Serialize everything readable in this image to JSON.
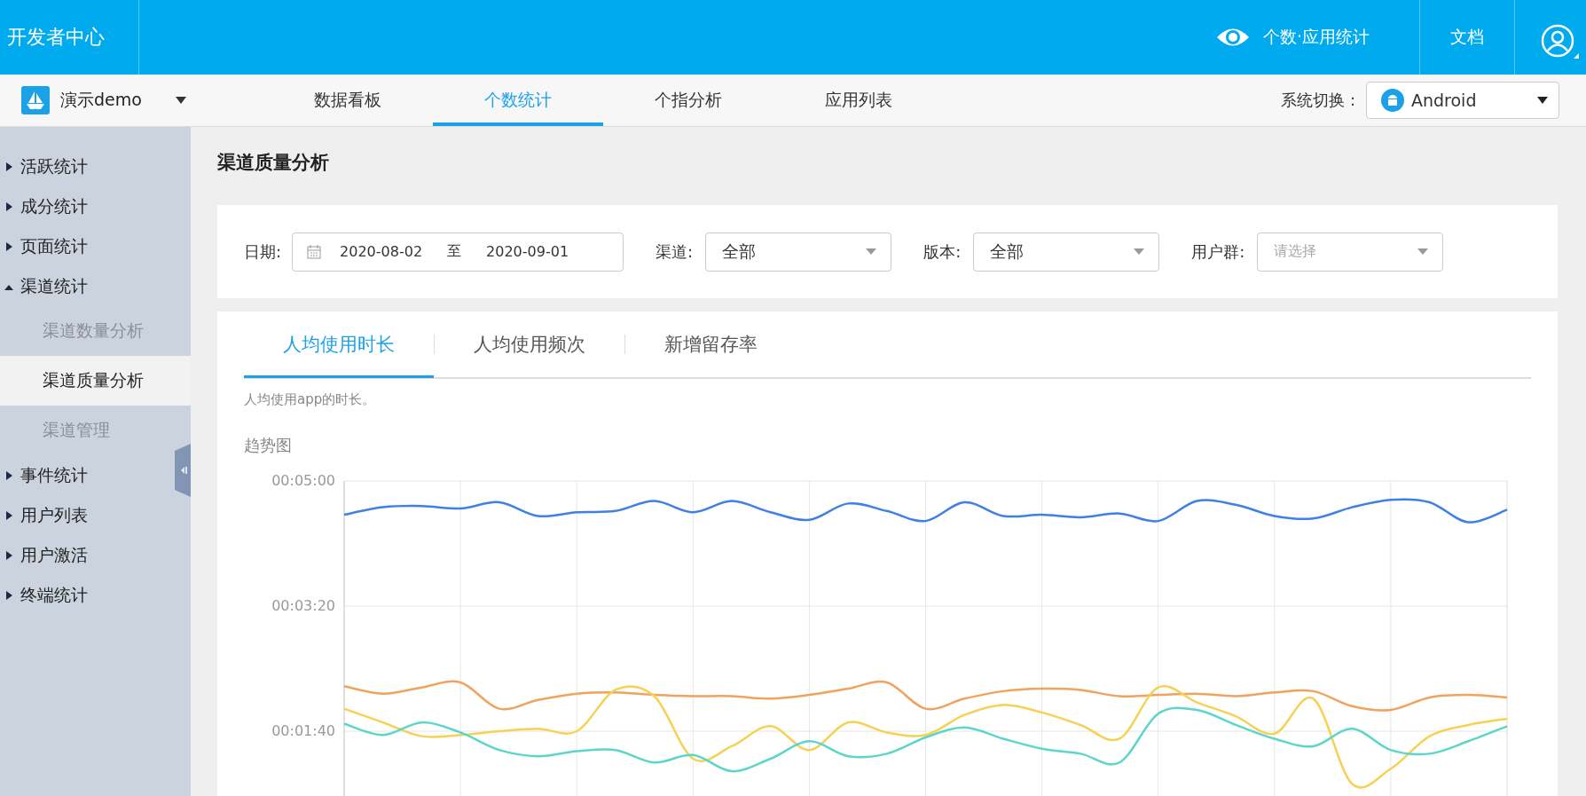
{
  "header": {
    "title": "开发者中心",
    "current_app": "个数·应用统计",
    "docs_link": "文档"
  },
  "nav": {
    "app_name": "演示demo",
    "tabs": [
      {
        "label": "数据看板",
        "selected": false
      },
      {
        "label": "个数统计",
        "selected": true
      },
      {
        "label": "个指分析",
        "selected": false
      },
      {
        "label": "应用列表",
        "selected": false
      }
    ],
    "system_label": "系统切换 :",
    "system_value": "Android"
  },
  "sidebar": {
    "items": [
      {
        "label": "活跃统计",
        "expanded": false
      },
      {
        "label": "成分统计",
        "expanded": false
      },
      {
        "label": "页面统计",
        "expanded": false
      },
      {
        "label": "渠道统计",
        "expanded": true,
        "children": [
          {
            "label": "渠道数量分析",
            "selected": false
          },
          {
            "label": "渠道质量分析",
            "selected": true
          },
          {
            "label": "渠道管理",
            "selected": false
          }
        ]
      },
      {
        "label": "事件统计",
        "expanded": false
      },
      {
        "label": "用户列表",
        "expanded": false
      },
      {
        "label": "用户激活",
        "expanded": false
      },
      {
        "label": "终端统计",
        "expanded": false
      }
    ]
  },
  "page_title": "渠道质量分析",
  "filters": {
    "date_label": "日期:",
    "date_start": "2020-08-02",
    "date_separator": "至",
    "date_end": "2020-09-01",
    "selects": [
      {
        "label": "渠道:",
        "value": "全部"
      },
      {
        "label": "版本:",
        "value": "全部"
      },
      {
        "label": "用户群:",
        "placeholder": "请选择"
      }
    ]
  },
  "metric_tabs": [
    {
      "label": "人均使用时长",
      "selected": true
    },
    {
      "label": "人均使用频次",
      "selected": false
    },
    {
      "label": "新增留存率",
      "selected": false
    }
  ],
  "description": "人均使用app的时长。",
  "chart_title": "趋势图",
  "chart_data": {
    "type": "line",
    "grid": true,
    "ylim": [
      0,
      300
    ],
    "yticks": [
      {
        "value": 100,
        "label": "00:01:40"
      },
      {
        "value": 200,
        "label": "00:03:20"
      },
      {
        "value": 300,
        "label": "00:05:00"
      }
    ],
    "series": [
      {
        "color": "#3f80e4",
        "values": [
          273,
          279,
          280,
          278,
          283,
          272,
          275,
          276,
          284,
          275,
          284,
          275,
          269,
          282,
          276,
          268,
          283,
          272,
          273,
          271,
          274,
          268,
          284,
          281,
          272,
          270,
          279,
          285,
          283,
          267,
          277
        ]
      },
      {
        "color": "#f0a35e",
        "values": [
          136,
          130,
          135,
          139,
          118,
          125,
          130,
          131,
          129,
          128,
          128,
          126,
          129,
          134,
          139,
          118,
          126,
          132,
          134,
          133,
          128,
          129,
          130,
          128,
          131,
          132,
          120,
          117,
          127,
          129,
          127
        ]
      },
      {
        "color": "#f5d154",
        "values": [
          118,
          107,
          96,
          97,
          100,
          102,
          100,
          133,
          128,
          78,
          88,
          104,
          85,
          107,
          99,
          97,
          113,
          121,
          115,
          105,
          94,
          135,
          123,
          112,
          98,
          126,
          58,
          70,
          96,
          105,
          110
        ]
      },
      {
        "color": "#5cd6c9",
        "values": [
          106,
          97,
          107,
          99,
          85,
          80,
          84,
          85,
          75,
          81,
          68,
          78,
          92,
          80,
          82,
          95,
          103,
          94,
          86,
          82,
          75,
          114,
          117,
          105,
          94,
          88,
          102,
          85,
          82,
          92,
          104
        ]
      }
    ]
  }
}
